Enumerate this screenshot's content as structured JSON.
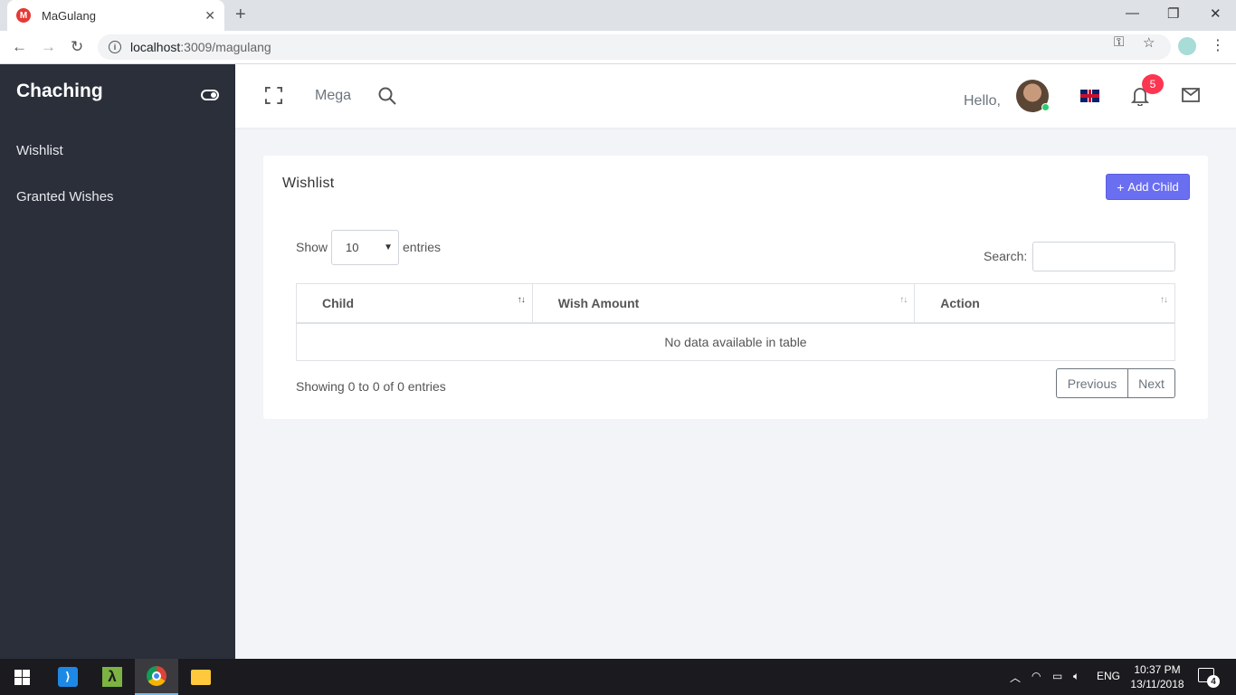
{
  "browser": {
    "tab_title": "MaGulang",
    "favicon_letter": "M",
    "url_host": "localhost",
    "url_path": ":3009/magulang"
  },
  "sidebar": {
    "brand": "Chaching",
    "items": [
      {
        "label": "Wishlist"
      },
      {
        "label": "Granted Wishes"
      }
    ]
  },
  "header": {
    "mega_label": "Mega",
    "greeting": "Hello,",
    "notification_count": "5"
  },
  "card": {
    "title": "Wishlist",
    "add_button_label": "Add Child",
    "show_label": "Show",
    "entries_value": "10",
    "entries_label": "entries",
    "search_label": "Search:",
    "search_value": "",
    "columns": [
      "Child",
      "Wish Amount",
      "Action"
    ],
    "empty_message": "No data available in table",
    "info": "Showing 0 to 0 of 0 entries",
    "prev_label": "Previous",
    "next_label": "Next"
  },
  "taskbar": {
    "language": "ENG",
    "time": "10:37 PM",
    "date": "13/11/2018",
    "notification_count": "4"
  },
  "colors": {
    "sidebar_bg": "#2a2f3a",
    "accent": "#6a6ef0",
    "badge": "#fd3550",
    "page_bg": "#f3f4f8"
  }
}
